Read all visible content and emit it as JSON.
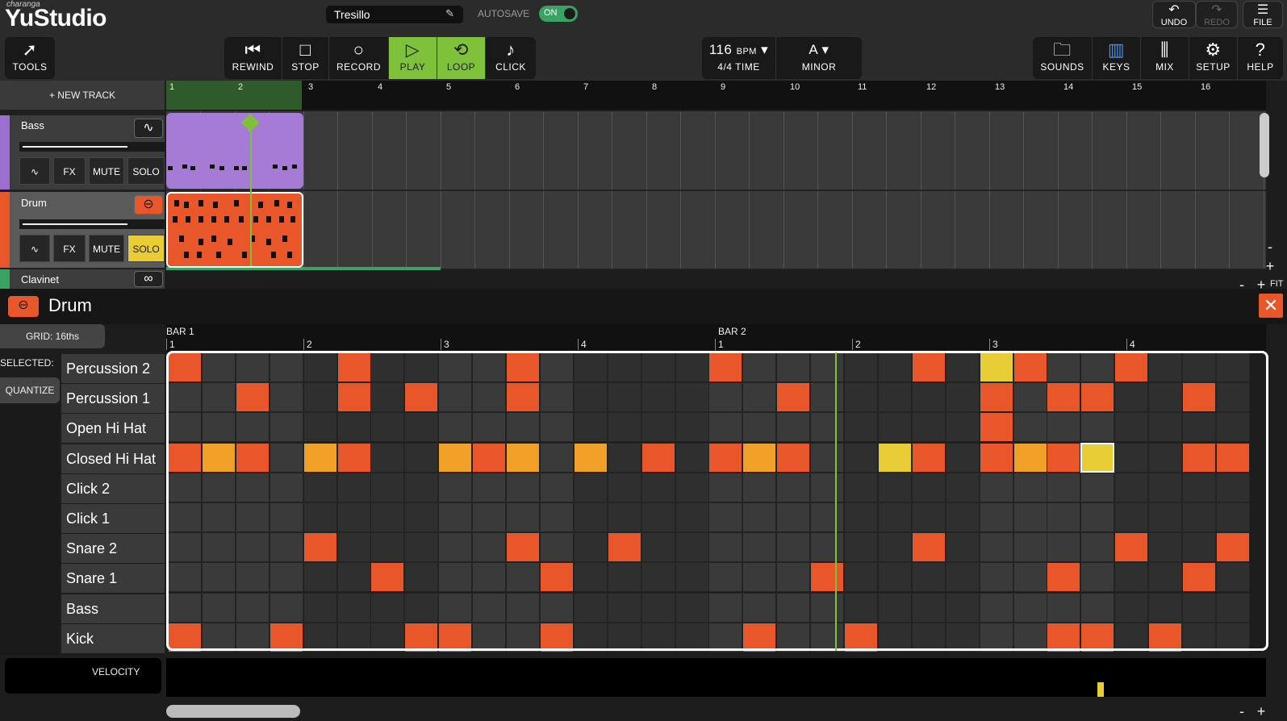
{
  "app": {
    "brand_small": "charanga",
    "brand": "YuStudio"
  },
  "project": {
    "name": "Tresillo",
    "autosave_label": "AUTOSAVE",
    "autosave_state": "ON"
  },
  "top_buttons": {
    "undo": "UNDO",
    "redo": "REDO",
    "file": "FILE"
  },
  "transport": {
    "tools": "TOOLS",
    "rewind": "REWIND",
    "stop": "STOP",
    "record": "RECORD",
    "play": "PLAY",
    "loop": "LOOP",
    "click": "CLICK"
  },
  "tempo": {
    "bpm": "116",
    "bpm_unit": "BPM",
    "time": "4/4 TIME",
    "key": "A",
    "scale": "MINOR"
  },
  "right_tools": {
    "sounds": "SOUNDS",
    "keys": "KEYS",
    "mix": "MIX",
    "setup": "SETUP",
    "help": "HELP"
  },
  "tracks_panel": {
    "new_track": "+ NEW TRACK",
    "bars": [
      "1",
      "2",
      "3",
      "4",
      "5",
      "6",
      "7",
      "8",
      "9",
      "10",
      "11",
      "12",
      "13",
      "14",
      "15",
      "16"
    ],
    "tracks": [
      {
        "name": "Bass",
        "color": "#9b6fcf",
        "fx": "FX",
        "mute": "MUTE",
        "solo": "SOLO",
        "icon": "sine-wave-icon"
      },
      {
        "name": "Drum",
        "color": "#e8562a",
        "fx": "FX",
        "mute": "MUTE",
        "solo": "SOLO",
        "icon": "drum-icon"
      },
      {
        "name": "Clavinet",
        "color": "#3aa363",
        "icon": "infinity-icon"
      }
    ],
    "zoom": {
      "minus": "-",
      "plus": "+",
      "fit": "FIT"
    }
  },
  "editor": {
    "title": "Drum",
    "grid": "GRID: 16ths",
    "selected": "SELECTED:",
    "quantize": "QUANTIZE",
    "bar1": "BAR 1",
    "bar2": "BAR 2",
    "beats": [
      "1",
      "2",
      "3",
      "4",
      "1",
      "2",
      "3",
      "4"
    ],
    "rows": [
      "Percussion 2",
      "Percussion 1",
      "Open Hi Hat",
      "Closed Hi Hat",
      "Click 2",
      "Click 1",
      "Snare 2",
      "Snare 1",
      "Bass",
      "Kick"
    ],
    "velocity": "VELOCITY",
    "colors": {
      "orange": "#e8562a",
      "amber": "#f0a026",
      "yellow": "#e8cc35",
      "green": "#7ec23b"
    }
  }
}
